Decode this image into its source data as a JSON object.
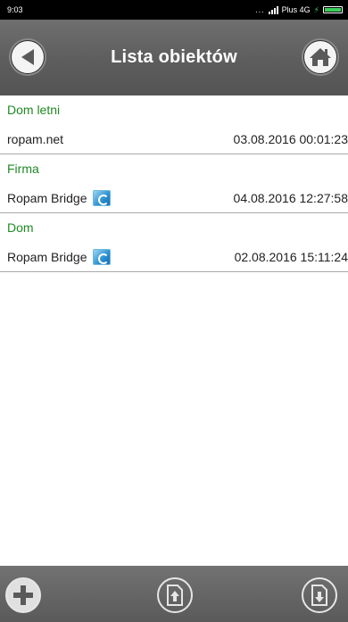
{
  "status_bar": {
    "time": "9:03",
    "carrier": "Plus 4G",
    "battery_color": "#3ad15a"
  },
  "header": {
    "title": "Lista obiektów",
    "back_icon": "back-arrow-icon",
    "home_icon": "home-icon"
  },
  "groups": [
    {
      "name": "Dom letni",
      "items": [
        {
          "name": "ropam.net",
          "date": "03.08.2016 00:01:23",
          "has_icon": false
        }
      ]
    },
    {
      "name": "Firma",
      "items": [
        {
          "name": "Ropam Bridge",
          "date": "04.08.2016 12:27:58",
          "has_icon": true
        }
      ]
    },
    {
      "name": "Dom",
      "items": [
        {
          "name": "Ropam Bridge",
          "date": "02.08.2016 15:11:24",
          "has_icon": true
        }
      ]
    }
  ],
  "colors": {
    "group_title": "#1f8a24",
    "header_bg": "#5d5d5d"
  },
  "toolbar": {
    "add_icon": "plus-icon",
    "import_icon": "file-upload-icon",
    "export_icon": "file-download-icon"
  }
}
